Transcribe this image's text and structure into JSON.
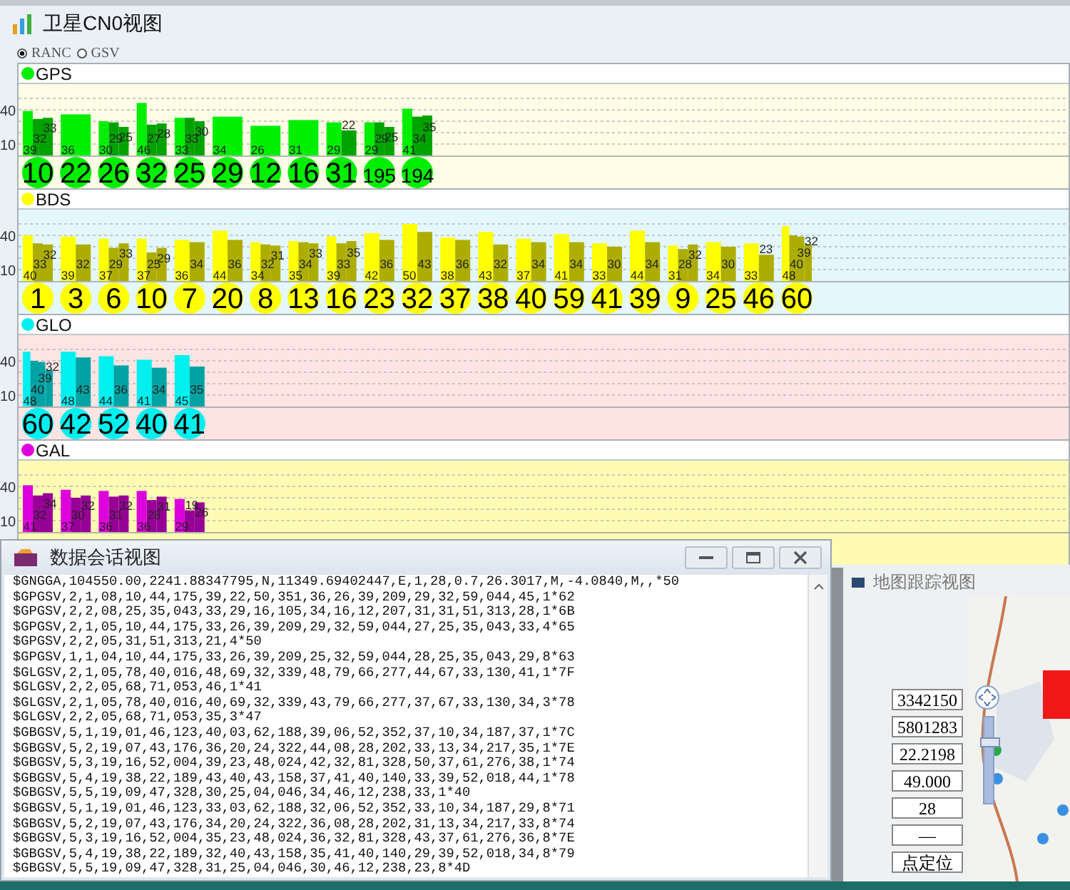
{
  "cn0_window": {
    "title": "卫星CN0视图",
    "radio_options": [
      {
        "label": "RANC",
        "selected": true
      },
      {
        "label": "GSV",
        "selected": false
      }
    ],
    "constellations": [
      {
        "name": "GPS",
        "color": "#00ee00",
        "y_labels": [
          "40",
          "10"
        ],
        "satellites": [
          {
            "prn": "10",
            "values": [
              "39",
              "32",
              "33"
            ]
          },
          {
            "prn": "22",
            "values": [
              "36"
            ]
          },
          {
            "prn": "26",
            "values": [
              "30",
              "29",
              "25"
            ]
          },
          {
            "prn": "32",
            "values": [
              "46",
              "27",
              "28"
            ]
          },
          {
            "prn": "25",
            "values": [
              "33",
              "33",
              "30"
            ]
          },
          {
            "prn": "29",
            "values": [
              "34"
            ]
          },
          {
            "prn": "12",
            "values": [
              "26"
            ]
          },
          {
            "prn": "16",
            "values": [
              "31"
            ]
          },
          {
            "prn": "31",
            "values": [
              "29",
              "22"
            ]
          },
          {
            "prn": "195",
            "values": [
              "29",
              "29",
              "25"
            ]
          },
          {
            "prn": "194",
            "values": [
              "41",
              "34",
              "35"
            ]
          }
        ]
      },
      {
        "name": "BDS",
        "color": "#ffff00",
        "y_labels": [
          "40",
          "10"
        ],
        "satellites": [
          {
            "prn": "1",
            "values": [
              "40",
              "33",
              "32"
            ]
          },
          {
            "prn": "3",
            "values": [
              "39",
              "32"
            ]
          },
          {
            "prn": "6",
            "values": [
              "37",
              "29",
              "33"
            ]
          },
          {
            "prn": "10",
            "values": [
              "37",
              "25",
              "29"
            ]
          },
          {
            "prn": "7",
            "values": [
              "36",
              "34"
            ]
          },
          {
            "prn": "20",
            "values": [
              "44",
              "36"
            ]
          },
          {
            "prn": "8",
            "values": [
              "34",
              "32",
              "31"
            ]
          },
          {
            "prn": "13",
            "values": [
              "35",
              "34",
              "33"
            ]
          },
          {
            "prn": "16",
            "values": [
              "39",
              "33",
              "35"
            ]
          },
          {
            "prn": "23",
            "values": [
              "42",
              "36"
            ]
          },
          {
            "prn": "32",
            "values": [
              "50",
              "43"
            ]
          },
          {
            "prn": "37",
            "values": [
              "38",
              "36"
            ]
          },
          {
            "prn": "38",
            "values": [
              "43",
              "32"
            ]
          },
          {
            "prn": "40",
            "values": [
              "37",
              "34"
            ]
          },
          {
            "prn": "59",
            "values": [
              "41",
              "34"
            ]
          },
          {
            "prn": "41",
            "values": [
              "33",
              "30"
            ]
          },
          {
            "prn": "39",
            "values": [
              "44",
              "34"
            ]
          },
          {
            "prn": "9",
            "values": [
              "31",
              "28",
              "32"
            ]
          },
          {
            "prn": "25",
            "values": [
              "34",
              "30"
            ]
          },
          {
            "prn": "46",
            "values": [
              "33",
              "23"
            ]
          },
          {
            "prn": "60",
            "values": [
              "48",
              "40",
              "39",
              "32"
            ]
          }
        ]
      },
      {
        "name": "GLO",
        "color": "#00f0f0",
        "y_labels": [
          "40",
          "10"
        ],
        "satellites": [
          {
            "prn": "60",
            "values": [
              "48",
              "40",
              "39",
              "32"
            ]
          },
          {
            "prn": "42",
            "values": [
              "48",
              "43"
            ]
          },
          {
            "prn": "52",
            "values": [
              "44",
              "36"
            ]
          },
          {
            "prn": "40",
            "values": [
              "41",
              "34"
            ]
          },
          {
            "prn": "41",
            "values": [
              "45",
              "35"
            ]
          }
        ]
      },
      {
        "name": "GAL",
        "color": "#dd00dd",
        "y_labels": [
          "40",
          "10"
        ],
        "satellites": [
          {
            "values": [
              "41",
              "32",
              "34"
            ]
          },
          {
            "values": [
              "37",
              "30",
              "32"
            ]
          },
          {
            "values": [
              "36",
              "31",
              "32"
            ]
          },
          {
            "values": [
              "36",
              "28",
              "31"
            ]
          },
          {
            "values": [
              "29",
              "19",
              "26"
            ]
          }
        ]
      }
    ]
  },
  "data_window": {
    "title": "数据会话视图",
    "lines": [
      "$GNGGA,104550.00,2241.88347795,N,11349.69402447,E,1,28,0.7,26.3017,M,-4.0840,M,,*50",
      "$GPGSV,2,1,08,10,44,175,39,22,50,351,36,26,39,209,29,32,59,044,45,1*62",
      "$GPGSV,2,2,08,25,35,043,33,29,16,105,34,16,12,207,31,31,51,313,28,1*6B",
      "$GPGSV,2,1,05,10,44,175,33,26,39,209,29,32,59,044,27,25,35,043,33,4*65",
      "$GPGSV,2,2,05,31,51,313,21,4*50",
      "$GPGSV,1,1,04,10,44,175,33,26,39,209,25,32,59,044,28,25,35,043,29,8*63",
      "$GLGSV,2,1,05,78,40,016,48,69,32,339,48,79,66,277,44,67,33,130,41,1*7F",
      "$GLGSV,2,2,05,68,71,053,46,1*41",
      "$GLGSV,2,1,05,78,40,016,40,69,32,339,43,79,66,277,37,67,33,130,34,3*78",
      "$GLGSV,2,2,05,68,71,053,35,3*47",
      "$GBGSV,5,1,19,01,46,123,40,03,62,188,39,06,52,352,37,10,34,187,37,1*7C",
      "$GBGSV,5,2,19,07,43,176,36,20,24,322,44,08,28,202,33,13,34,217,35,1*7E",
      "$GBGSV,5,3,19,16,52,004,39,23,48,024,42,32,81,328,50,37,61,276,38,1*74",
      "$GBGSV,5,4,19,38,22,189,43,40,43,158,37,41,40,140,33,39,52,018,44,1*78",
      "$GBGSV,5,5,19,09,47,328,30,25,04,046,34,46,12,238,33,1*40",
      "$GBGSV,5,1,19,01,46,123,33,03,62,188,32,06,52,352,33,10,34,187,29,8*71",
      "$GBGSV,5,2,19,07,43,176,34,20,24,322,36,08,28,202,31,13,34,217,33,8*74",
      "$GBGSV,5,3,19,16,52,004,35,23,48,024,36,32,81,328,43,37,61,276,36,8*7E",
      "$GBGSV,5,4,19,38,22,189,32,40,43,158,35,41,40,140,29,39,52,018,34,8*79",
      "$GBGSV,5,5,19,09,47,328,31,25,04,046,30,46,12,238,23,8*4D"
    ]
  },
  "map_window": {
    "title": "地图跟踪视图",
    "fields": [
      "3342150",
      "5801283",
      "22.2198",
      "49.000",
      "28",
      "—",
      "点定位"
    ],
    "zoom_slider": {
      "level": 0.7
    }
  }
}
